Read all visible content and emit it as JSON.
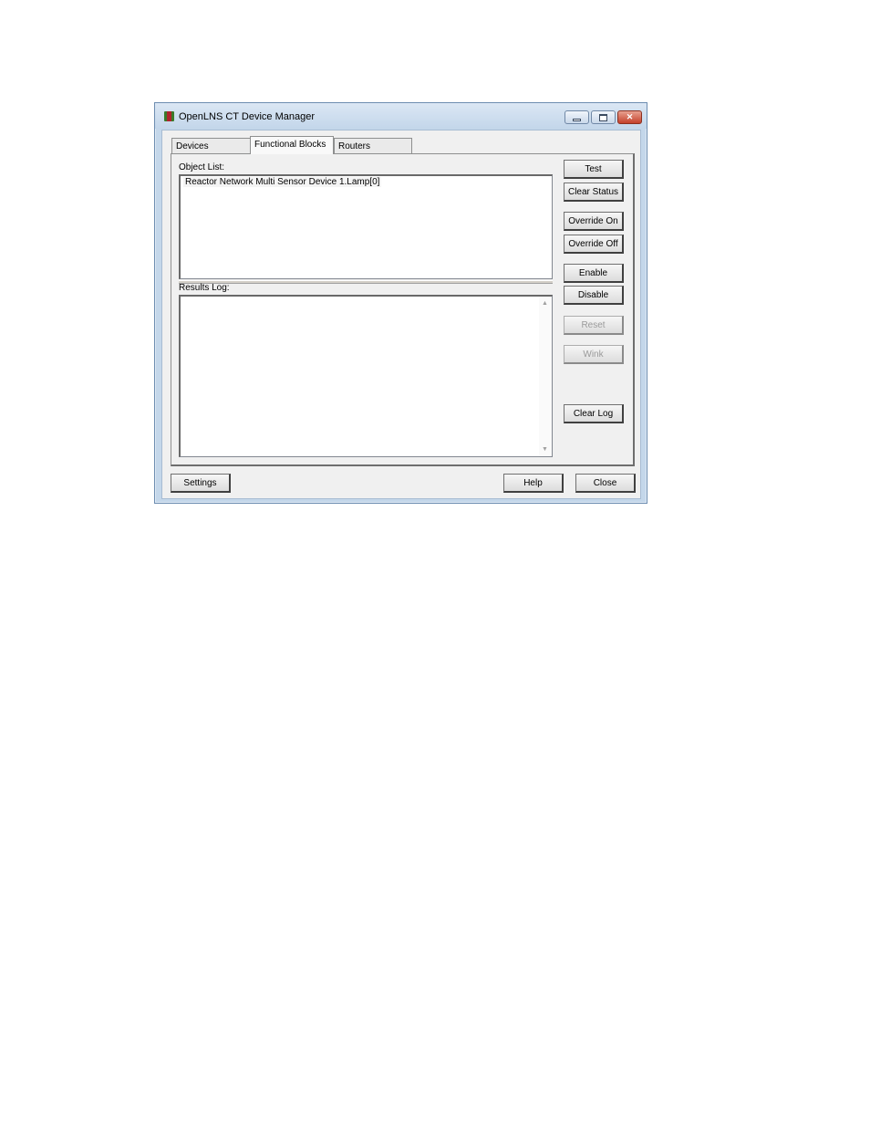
{
  "window": {
    "title": "OpenLNS CT Device Manager",
    "min_icon": "minimize-icon",
    "max_icon": "maximize-icon",
    "close_icon": "close-icon",
    "close_glyph": "✕"
  },
  "tabs": [
    {
      "label": "Devices"
    },
    {
      "label": "Functional Blocks",
      "active": true
    },
    {
      "label": "Routers"
    }
  ],
  "object_list": {
    "label": "Object List:",
    "items": [
      "Reactor Network Multi Sensor Device 1.Lamp[0]"
    ]
  },
  "results_log": {
    "label": "Results Log:",
    "scroll_up": "▲",
    "scroll_down": "▼"
  },
  "side_buttons": {
    "test": "Test",
    "clear_status": "Clear Status",
    "override_on": "Override On",
    "override_off": "Override Off",
    "enable": "Enable",
    "disable": "Disable",
    "reset": "Reset",
    "wink": "Wink",
    "clear_log": "Clear Log"
  },
  "bottom_buttons": {
    "settings": "Settings",
    "help": "Help",
    "close": "Close"
  }
}
